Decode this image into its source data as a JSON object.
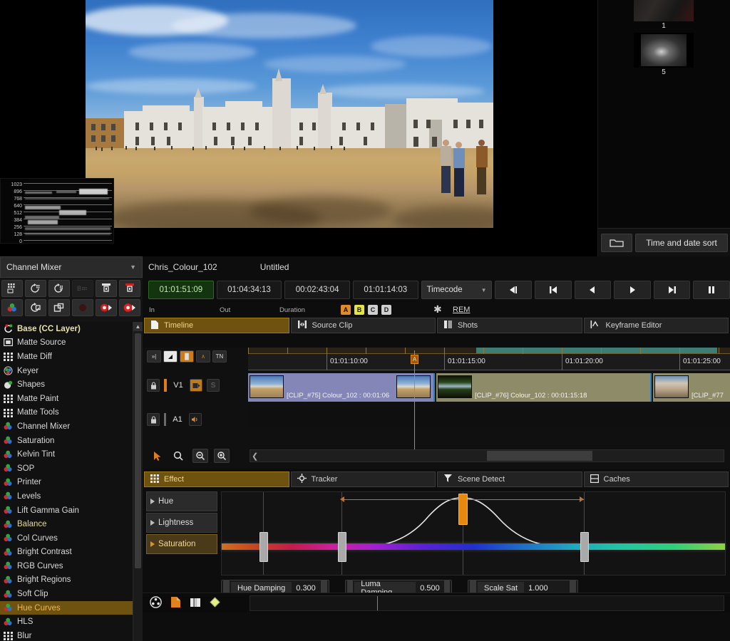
{
  "viewer": {
    "scope": {
      "name": "waveform-scope",
      "labels": [
        "1023",
        "896",
        "768",
        "640",
        "512",
        "384",
        "256",
        "128",
        "0"
      ]
    }
  },
  "bin": {
    "thumbnails": [
      {
        "caption": "1"
      },
      {
        "caption": "5"
      }
    ],
    "folder_icon": "folder-icon",
    "sort_label": "Time and date sort"
  },
  "left_panel": {
    "selector": {
      "value": "Channel Mixer",
      "chevron": "chevron-down-icon"
    },
    "tool_row_1": [
      {
        "name": "matte-grid-icon"
      },
      {
        "name": "rotate-grid-icon"
      },
      {
        "name": "rotate-grid-alt-icon"
      },
      {
        "name": "blur-text-icon"
      },
      {
        "name": "import-gate-icon"
      },
      {
        "name": "export-gate-icon"
      }
    ],
    "tool_row_2": [
      {
        "name": "color-balls-icon"
      },
      {
        "name": "copy-rotate-icon"
      },
      {
        "name": "duplicate-icon"
      },
      {
        "name": "record-off-icon"
      },
      {
        "name": "record-cam-icon"
      },
      {
        "name": "record-cam-active-icon"
      }
    ],
    "effects": [
      {
        "label": "Base (CC Layer)",
        "icon": "cc-layer-icon",
        "style": "head"
      },
      {
        "label": "Matte Source",
        "icon": "matte-source-icon",
        "style": ""
      },
      {
        "label": "Matte Diff",
        "icon": "grid-icon",
        "style": ""
      },
      {
        "label": "Keyer",
        "icon": "keyer-icon",
        "style": ""
      },
      {
        "label": "Shapes",
        "icon": "shapes-icon",
        "style": ""
      },
      {
        "label": "Matte Paint",
        "icon": "grid-icon",
        "style": ""
      },
      {
        "label": "Matte Tools",
        "icon": "grid-icon",
        "style": ""
      },
      {
        "label": "Channel Mixer",
        "icon": "color-balls-icon",
        "style": ""
      },
      {
        "label": "Saturation",
        "icon": "color-balls-icon",
        "style": ""
      },
      {
        "label": "Kelvin Tint",
        "icon": "color-balls-icon",
        "style": ""
      },
      {
        "label": "SOP",
        "icon": "color-balls-icon",
        "style": ""
      },
      {
        "label": "Printer",
        "icon": "color-balls-icon",
        "style": ""
      },
      {
        "label": "Levels",
        "icon": "color-balls-icon",
        "style": ""
      },
      {
        "label": "Lift Gamma Gain",
        "icon": "color-balls-icon",
        "style": ""
      },
      {
        "label": "Balance",
        "icon": "color-balls-icon",
        "style": "gold"
      },
      {
        "label": "Col Curves",
        "icon": "color-balls-icon",
        "style": ""
      },
      {
        "label": "Bright Contrast",
        "icon": "color-balls-icon",
        "style": ""
      },
      {
        "label": "RGB Curves",
        "icon": "color-balls-icon",
        "style": ""
      },
      {
        "label": "Bright Regions",
        "icon": "color-balls-icon",
        "style": ""
      },
      {
        "label": "Soft Clip",
        "icon": "color-balls-icon",
        "style": ""
      },
      {
        "label": "Hue Curves",
        "icon": "color-balls-icon",
        "style": "sel"
      },
      {
        "label": "HLS",
        "icon": "color-balls-icon",
        "style": ""
      },
      {
        "label": "Blur",
        "icon": "grid-icon",
        "style": ""
      }
    ]
  },
  "header": {
    "project_name": "Chris_Colour_102",
    "sequence_name": "Untitled",
    "timecodes": [
      {
        "value": "01:01:51:09",
        "label": "In",
        "active": true
      },
      {
        "value": "01:04:34:13",
        "label": "Out",
        "active": false
      },
      {
        "value": "00:02:43:04",
        "label": "Duration",
        "active": false
      },
      {
        "value": "01:01:14:03",
        "label": "",
        "active": false
      }
    ],
    "mode_select": {
      "value": "Timecode",
      "chevron": "chevron-down-icon"
    },
    "transport": [
      {
        "name": "step-back-icon",
        "glyph": "prev-frame"
      },
      {
        "name": "go-to-start-icon",
        "glyph": "start"
      },
      {
        "name": "play-reverse-icon",
        "glyph": "rev"
      },
      {
        "name": "play-forward-icon",
        "glyph": "fwd"
      },
      {
        "name": "go-to-end-icon",
        "glyph": "end"
      },
      {
        "name": "pause-icon",
        "glyph": "pause"
      }
    ],
    "abcd_buttons": [
      {
        "label": "A",
        "color": "#e08a2a",
        "text": "#1a1008"
      },
      {
        "label": "B",
        "color": "#e4e44a",
        "text": "#17170a"
      },
      {
        "label": "C",
        "color": "#cfcfcf",
        "text": "#161616"
      },
      {
        "label": "D",
        "color": "#cfcfcf",
        "text": "#161616"
      }
    ],
    "star_icon": "asterisk-icon",
    "rem_label": "REM"
  },
  "panel_tabs": [
    {
      "label": "Timeline",
      "icon": "page-icon",
      "active": true
    },
    {
      "label": "Source Clip",
      "icon": "source-clip-icon",
      "active": false
    },
    {
      "label": "Shots",
      "icon": "shots-icon",
      "active": false
    },
    {
      "label": "Keyframe Editor",
      "icon": "keyframe-icon",
      "active": false
    }
  ],
  "timeline": {
    "tools": [
      {
        "name": "insert-icon",
        "glyph": "»|"
      },
      {
        "name": "transition-icon",
        "glyph": "◨"
      },
      {
        "name": "color-clip-icon",
        "glyph": "▓"
      },
      {
        "name": "curve-icon",
        "glyph": "∧"
      },
      {
        "name": "thumbnail-toggle-icon",
        "glyph": "TN"
      }
    ],
    "ruler_labels": [
      "01:01:10:00",
      "01:01:15:00",
      "01:01:20:00",
      "01:01:25:00"
    ],
    "tracks": [
      {
        "name": "V1",
        "lock_icon": "lock-icon",
        "enable_icon": "video-enable-icon",
        "solo_label": "S"
      },
      {
        "name": "A1",
        "lock_icon": "lock-icon",
        "enable_icon": "audio-enable-icon",
        "solo_label": ""
      }
    ],
    "clips": [
      {
        "label": "[CLIP_#75] Colour_102 : 00:01:06",
        "color": "#8486b8"
      },
      {
        "label": "[CLIP_#76] Colour_102 : 00:01:15:18",
        "color": "#8e8c68"
      },
      {
        "label": "[CLIP_#77",
        "color": "#8e8c68"
      }
    ],
    "playhead_marker": "A"
  },
  "timeline_bottom": {
    "tools": [
      {
        "name": "select-arrow-icon"
      },
      {
        "name": "zoom-query-icon"
      },
      {
        "name": "zoom-out-icon"
      },
      {
        "name": "zoom-in-icon"
      }
    ],
    "scroll_left_icon": "chevron-left-icon"
  },
  "effect_tabs": [
    {
      "label": "Effect",
      "icon": "grid-icon",
      "active": true
    },
    {
      "label": "Tracker",
      "icon": "tracker-icon",
      "active": false
    },
    {
      "label": "Scene Detect",
      "icon": "scene-detect-icon",
      "active": false
    },
    {
      "label": "Caches",
      "icon": "caches-icon",
      "active": false
    }
  ],
  "curve_editor": {
    "channel_tabs": [
      {
        "label": "Hue",
        "selected": false
      },
      {
        "label": "Lightness",
        "selected": false
      },
      {
        "label": "Saturation",
        "selected": true
      }
    ],
    "params": [
      {
        "name": "Hue Damping",
        "value": "0.300"
      },
      {
        "name": "Luma Damping",
        "value": "0.500"
      },
      {
        "name": "Scale Sat",
        "value": "1.000"
      }
    ],
    "handles": [
      {
        "x_pct": 25,
        "kind": "grey"
      },
      {
        "x_pct": 70,
        "kind": "grey"
      },
      {
        "x_pct": 100,
        "kind": "orange"
      },
      {
        "x_pct": 160,
        "kind": "grey"
      }
    ]
  },
  "bottom_strip": {
    "icons": [
      {
        "name": "reel-icon"
      },
      {
        "name": "orange-page-icon"
      },
      {
        "name": "split-view-icon"
      },
      {
        "name": "diamond-keyframe-icon"
      }
    ]
  },
  "colors": {
    "accent_gold": "#6e5210",
    "accent_orange": "#e0912c",
    "playhead": "#e07b20",
    "active_green": "#14330f"
  }
}
